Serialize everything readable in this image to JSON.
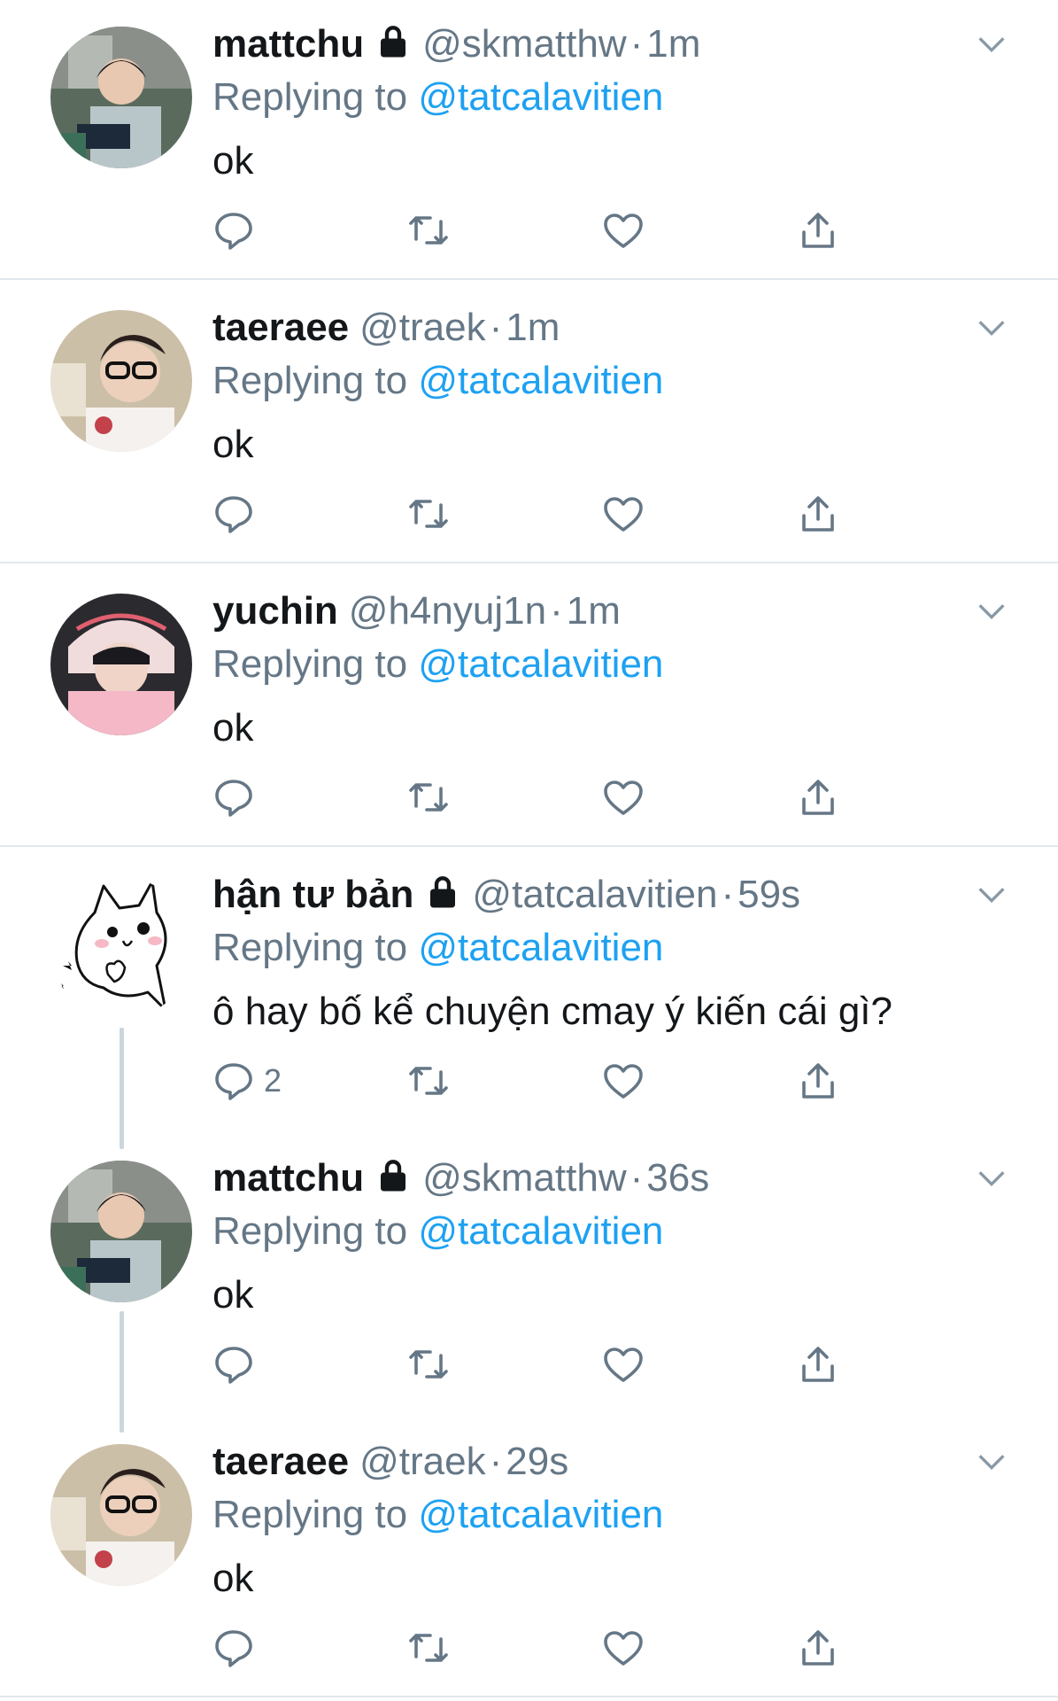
{
  "tweets": [
    {
      "name": "mattchu",
      "locked": true,
      "handle": "@skmatthw",
      "time": "1m",
      "replying_label": "Replying to",
      "mention": "@tatcalavitien",
      "text": "ok",
      "reply_count": "",
      "avatar": "avatar-mattchu"
    },
    {
      "name": "taeraee",
      "locked": false,
      "handle": "@traek",
      "time": "1m",
      "replying_label": "Replying to",
      "mention": "@tatcalavitien",
      "text": "ok",
      "reply_count": "",
      "avatar": "avatar-taeraee"
    },
    {
      "name": "yuchin",
      "locked": false,
      "handle": "@h4nyuj1n",
      "time": "1m",
      "replying_label": "Replying to",
      "mention": "@tatcalavitien",
      "text": "ok",
      "reply_count": "",
      "avatar": "avatar-yuchin"
    },
    {
      "name": "hận tư bản",
      "locked": true,
      "handle": "@tatcalavitien",
      "time": "59s",
      "replying_label": "Replying to",
      "mention": "@tatcalavitien",
      "text": "ô hay bố kể chuyện cmay ý kiến cái gì?",
      "reply_count": "2",
      "avatar": "avatar-cat"
    },
    {
      "name": "mattchu",
      "locked": true,
      "handle": "@skmatthw",
      "time": "36s",
      "replying_label": "Replying to",
      "mention": "@tatcalavitien",
      "text": "ok",
      "reply_count": "",
      "avatar": "avatar-mattchu"
    },
    {
      "name": "taeraee",
      "locked": false,
      "handle": "@traek",
      "time": "29s",
      "replying_label": "Replying to",
      "mention": "@tatcalavitien",
      "text": "ok",
      "reply_count": "",
      "avatar": "avatar-taeraee"
    }
  ],
  "colors": {
    "link": "#1da1f2",
    "muted": "#657786",
    "text": "#14171a",
    "divider": "#e1e8ed"
  },
  "separator": "·"
}
